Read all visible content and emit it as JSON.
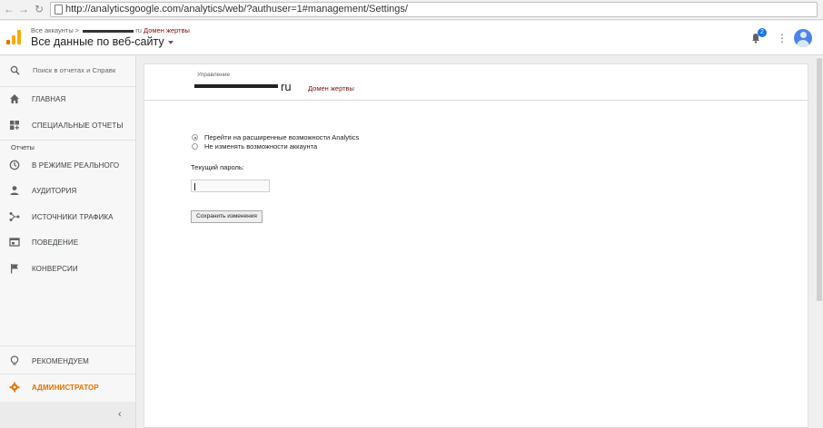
{
  "browser": {
    "url": "http://analyticsgoogle.com/analytics/web/?authuser=1#management/Settings/"
  },
  "header": {
    "breadcrumb_prefix": "Все аккаунты >",
    "breadcrumb_suffix": "ru",
    "breadcrumb_domain": "Домен жертвы",
    "view_title": "Все данные по веб-сайту",
    "notification_count": "2"
  },
  "sidebar": {
    "search_placeholder": "Поиск в отчетах и Справк",
    "items": [
      {
        "label": "ГЛАВНАЯ",
        "icon": "home-icon"
      },
      {
        "label": "СПЕЦИАЛЬНЫЕ ОТЧЕТЫ",
        "icon": "custom-reports-icon"
      },
      {
        "label": "В РЕЖИМЕ РЕАЛЬНОГО",
        "icon": "clock-icon"
      },
      {
        "label": "АУДИТОРИЯ",
        "icon": "person-icon"
      },
      {
        "label": "ИСТОЧНИКИ ТРАФИКА",
        "icon": "acquisition-icon"
      },
      {
        "label": "ПОВЕДЕНИЕ",
        "icon": "behavior-icon"
      },
      {
        "label": "КОНВЕРСИИ",
        "icon": "flag-icon"
      }
    ],
    "section_reports": "Отчеты",
    "recommend": "РЕКОМЕНДУЕМ",
    "admin": "АДМИНИСТРАТОР",
    "accent_color": "#e37400"
  },
  "main": {
    "management_label": "Управление",
    "account_name_suffix": "ru",
    "account_domain": "Домен жертвы",
    "radio_options": [
      {
        "label": "Перейти на расширенные возможности Analytics",
        "checked": true
      },
      {
        "label": "Не изменять возможности аккаунта",
        "checked": false
      }
    ],
    "password_label": "Текущий пароль:",
    "password_value": "",
    "save_button": "Сохранить изменения"
  }
}
